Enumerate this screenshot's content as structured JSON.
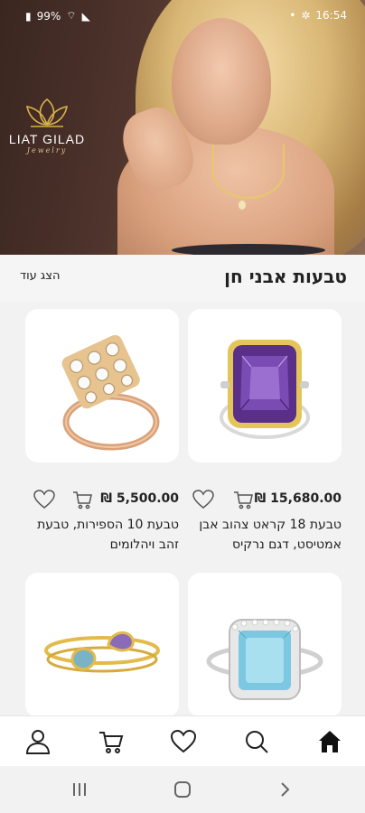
{
  "status_bar": {
    "battery": "99%",
    "time": "16:54"
  },
  "brand": {
    "name": "LIAT GILAD",
    "tagline": "Jewelry"
  },
  "section": {
    "title": "טבעות אבני חן",
    "show_more": "הצג עוד"
  },
  "products": [
    {
      "name": "טבעת 18 קראט צהוב אבן אמטיסט, דגם נרקיס",
      "price": "15,680.00 ₪"
    },
    {
      "name": "טבעת 10 הספירות, טבעת זהב ויהלומים",
      "price": "5,500.00 ₪"
    },
    {
      "name": "",
      "price": ""
    },
    {
      "name": "",
      "price": ""
    }
  ],
  "nav": [
    "home-icon",
    "search-icon",
    "heart-icon",
    "cart-icon",
    "user-icon"
  ],
  "colors": {
    "accent": "#d8b24a",
    "amethyst": "#6b3fa0",
    "topaz": "#8fd4e8"
  }
}
